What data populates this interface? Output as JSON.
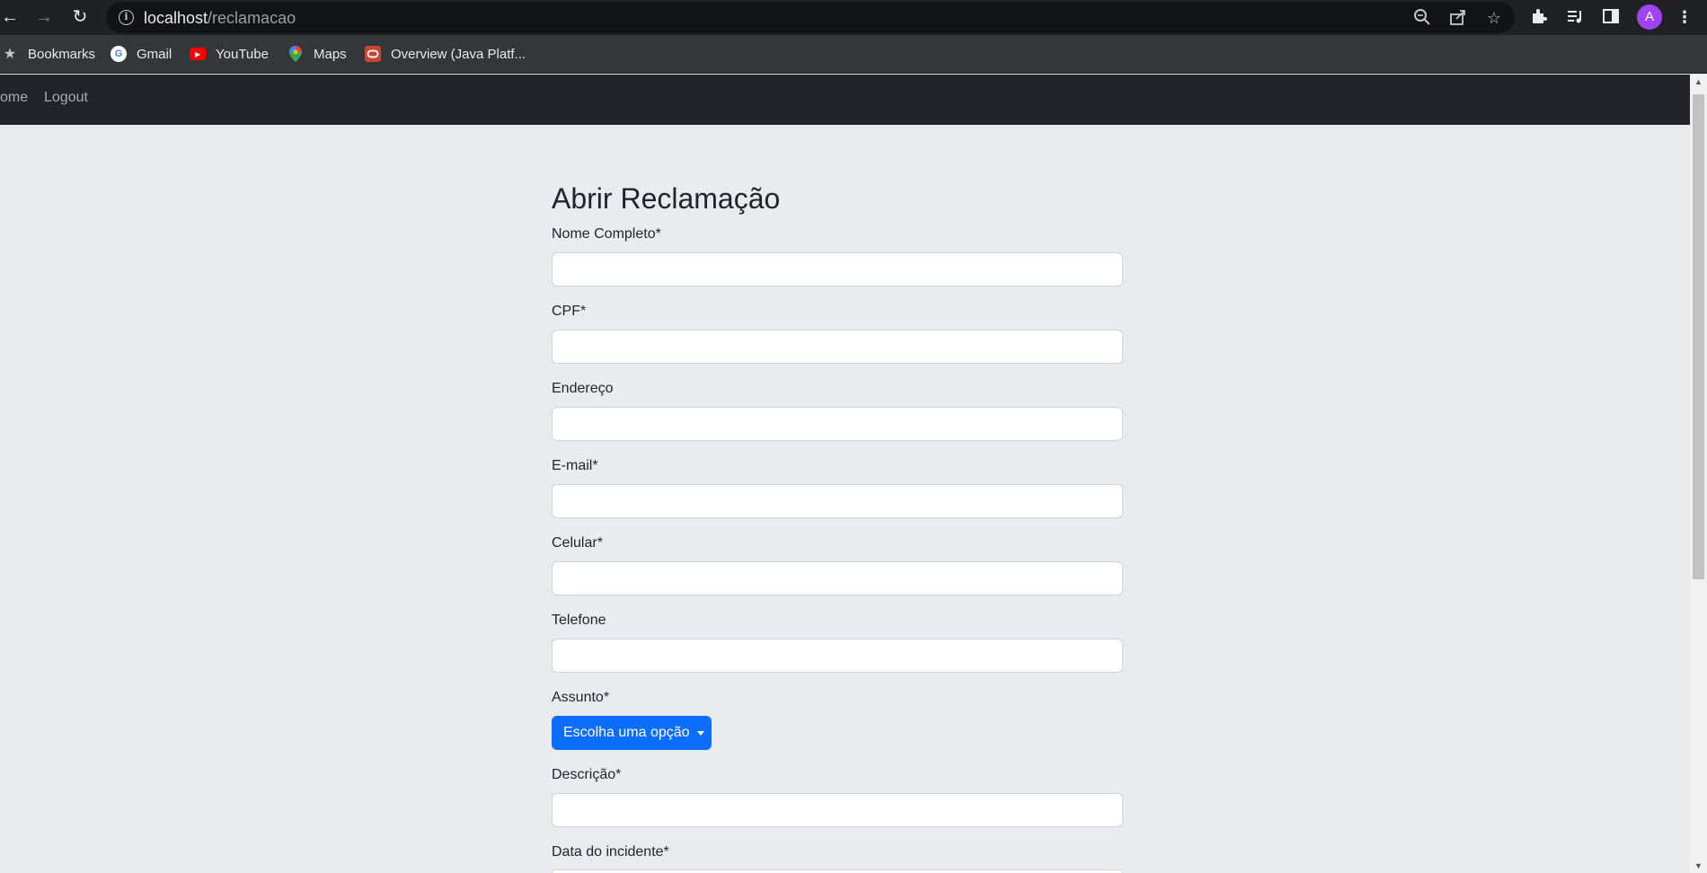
{
  "browser": {
    "url_host": "localhost",
    "url_path": "/reclamacao",
    "avatar_letter": "A",
    "icons": {
      "back": "arrow-left-icon",
      "forward": "arrow-right-icon",
      "reload": "reload-icon",
      "site_info": "info-icon",
      "zoom": "zoom-icon",
      "share": "share-icon",
      "bookmark_star": "star-icon",
      "extensions": "puzzle-icon",
      "media": "media-queue-icon",
      "side_panel": "side-panel-icon",
      "menu": "kebab-menu-icon"
    }
  },
  "bookmarks": [
    {
      "label": "Bookmarks",
      "icon": "star-icon"
    },
    {
      "label": "Gmail",
      "icon": "google-icon"
    },
    {
      "label": "YouTube",
      "icon": "youtube-icon"
    },
    {
      "label": "Maps",
      "icon": "maps-pin-icon"
    },
    {
      "label": "Overview (Java Platf...",
      "icon": "oracle-icon"
    }
  ],
  "navbar": {
    "home_label": "ome",
    "logout_label": "Logout",
    "background": "#212529"
  },
  "form": {
    "title": "Abrir Reclamação",
    "fields": [
      {
        "label": "Nome Completo*",
        "value": ""
      },
      {
        "label": "CPF*",
        "value": ""
      },
      {
        "label": "Endereço",
        "value": ""
      },
      {
        "label": "E-mail*",
        "value": ""
      },
      {
        "label": "Celular*",
        "value": ""
      },
      {
        "label": "Telefone",
        "value": ""
      }
    ],
    "assunto_label": "Assunto*",
    "assunto_button": "Escolha uma opção",
    "descricao_label": "Descrição*",
    "descricao_value": "",
    "data_label": "Data do incidente*",
    "accent": "#0d6efd",
    "page_background": "#e9ecef"
  }
}
